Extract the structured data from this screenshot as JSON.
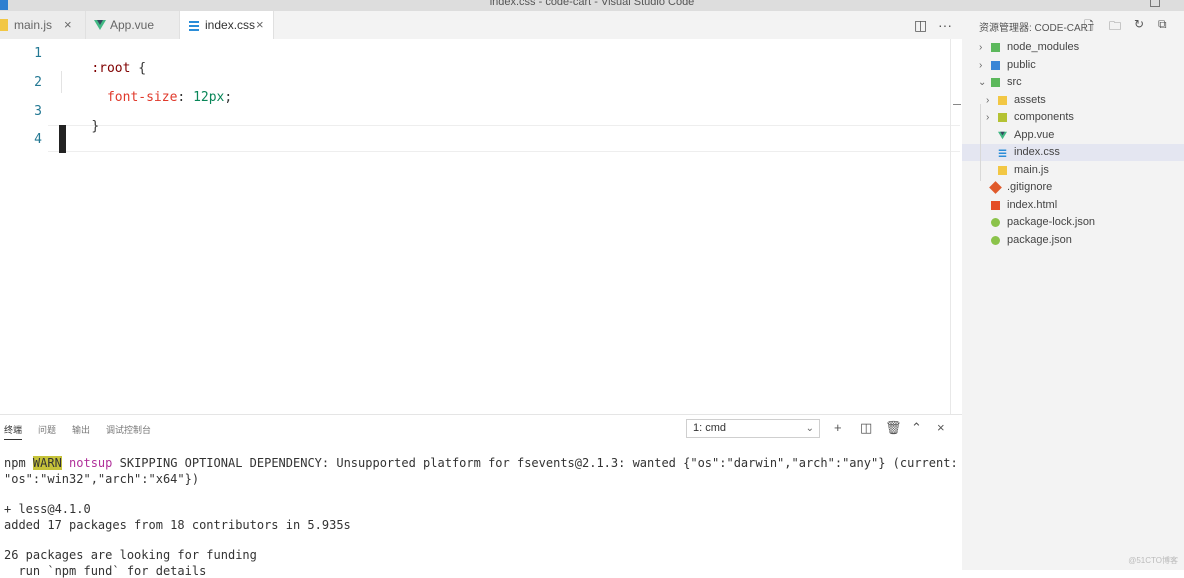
{
  "window": {
    "title": "index.css - code-cart - Visual Studio Code"
  },
  "tabs": [
    {
      "label": "main.js",
      "icon": "js-file-icon",
      "color": "#f2c744",
      "active": false
    },
    {
      "label": "App.vue",
      "icon": "vue-file-icon",
      "color": "#41b883",
      "active": false
    },
    {
      "label": "index.css",
      "icon": "css-file-icon",
      "color": "#2b8dd8",
      "active": true
    }
  ],
  "editor": {
    "lines": [
      {
        "num": "1",
        "tokens": [
          {
            "text": ":root",
            "color": "#800000"
          },
          {
            "text": " {",
            "color": "#333333"
          }
        ]
      },
      {
        "num": "2",
        "tokens": [
          {
            "text": "  font-size",
            "color": "#e0392b"
          },
          {
            "text": ": ",
            "color": "#333333"
          },
          {
            "text": "12px",
            "color": "#098658"
          },
          {
            "text": ";",
            "color": "#333333"
          }
        ]
      },
      {
        "num": "3",
        "tokens": [
          {
            "text": "}",
            "color": "#333333"
          }
        ]
      },
      {
        "num": "4",
        "tokens": []
      }
    ]
  },
  "panel": {
    "tabs": [
      "终端",
      "问题",
      "输出",
      "调试控制台"
    ],
    "active_tab": "终端",
    "terminal_select": "1: cmd",
    "terminal": {
      "l1_npm": "npm ",
      "l1_warn": "WARN",
      "l1_notsup": " notsup",
      "l1_rest": " SKIPPING OPTIONAL DEPENDENCY: Unsupported platform for fsevents@2.1.3: wanted {\"os\":\"darwin\",\"arch\":\"any\"} (current: {",
      "l2": "\"os\":\"win32\",\"arch\":\"x64\"})",
      "l3": "+ less@4.1.0",
      "l4": "added 17 packages from 18 contributors in 5.935s",
      "l5": "26 packages are looking for funding",
      "l6": "  run `npm fund` for details"
    }
  },
  "explorer": {
    "header": "资源管理器: CODE-CART",
    "tree": [
      {
        "label": "node_modules",
        "type": "folder",
        "chev": "›",
        "icon": "folder-icon",
        "color": "#5cb85c"
      },
      {
        "label": "public",
        "type": "folder",
        "chev": "›",
        "icon": "folder-icon",
        "color": "#3a86d6"
      },
      {
        "label": "src",
        "type": "folder",
        "chev": "⌄",
        "icon": "folder-open-icon",
        "color": "#5cb85c"
      },
      {
        "label": "assets",
        "type": "folder",
        "chev": "›",
        "icon": "folder-icon",
        "color": "#f2c744"
      },
      {
        "label": "components",
        "type": "folder",
        "chev": "›",
        "icon": "folder-icon",
        "color": "#b4c233"
      },
      {
        "label": "App.vue",
        "type": "file",
        "icon": "vue-file-icon",
        "color": "#41b883"
      },
      {
        "label": "index.css",
        "type": "file",
        "icon": "css-file-icon",
        "color": "#2b8dd8",
        "selected": true
      },
      {
        "label": "main.js",
        "type": "file",
        "icon": "js-file-icon",
        "color": "#f2c744"
      },
      {
        "label": ".gitignore",
        "type": "file",
        "icon": "git-icon",
        "color": "#e05a2b"
      },
      {
        "label": "index.html",
        "type": "file",
        "icon": "html-file-icon",
        "color": "#e44d26"
      },
      {
        "label": "package-lock.json",
        "type": "file",
        "icon": "npm-file-icon",
        "color": "#8bc34a"
      },
      {
        "label": "package.json",
        "type": "file",
        "icon": "npm-file-icon",
        "color": "#8bc34a"
      }
    ]
  },
  "watermark": "@51CTO博客"
}
